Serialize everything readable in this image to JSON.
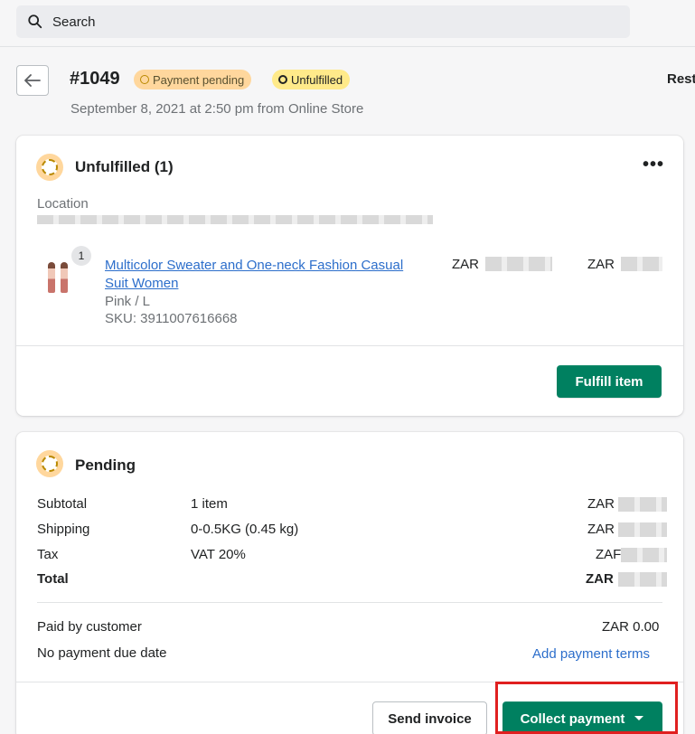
{
  "search": {
    "placeholder": "Search"
  },
  "order": {
    "number": "#1049",
    "payment_badge": "Payment pending",
    "fulfillment_badge": "Unfulfilled",
    "date": "September 8, 2021 at 2:50 pm from Online Store",
    "restock_label": "Rest"
  },
  "unfulfilled_card": {
    "title": "Unfulfilled (1)",
    "location_label": "Location",
    "item": {
      "quantity": "1",
      "name": "Multicolor Sweater and One-neck Fashion Casual Suit Women",
      "variant": "Pink / L",
      "sku": "SKU: 3911007616668",
      "unit_price_prefix": "ZAR",
      "total_price_prefix": "ZAR"
    },
    "fulfill_button": "Fulfill item"
  },
  "pending_card": {
    "title": "Pending",
    "rows": [
      {
        "label": "Subtotal",
        "detail": "1 item",
        "value": "ZAR"
      },
      {
        "label": "Shipping",
        "detail": "0-0.5KG (0.45 kg)",
        "value": "ZAR"
      },
      {
        "label": "Tax",
        "detail": "VAT 20%",
        "value": "ZAF"
      },
      {
        "label": "Total",
        "detail": "",
        "value": "ZAR"
      }
    ],
    "paid_by_customer_label": "Paid by customer",
    "paid_by_customer_value": "ZAR 0.00",
    "due_date_label": "No payment due date",
    "add_terms_link": "Add payment terms",
    "send_invoice_button": "Send invoice",
    "collect_payment_button": "Collect payment"
  },
  "colors": {
    "primary": "#008060",
    "link": "#2c6ecb",
    "badge_attention": "#ffd79d",
    "badge_warning": "#ffea8a",
    "highlight": "#e02020"
  }
}
